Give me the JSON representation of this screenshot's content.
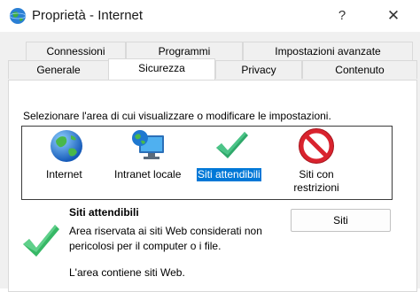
{
  "window": {
    "title": "Proprietà - Internet",
    "help_label": "?",
    "close_label": "✕"
  },
  "tabs": {
    "row1": [
      "Connessioni",
      "Programmi",
      "Impostazioni avanzate"
    ],
    "row2": [
      "Generale",
      "Sicurezza",
      "Privacy",
      "Contenuto"
    ],
    "active": "Sicurezza"
  },
  "security": {
    "instruction": "Selezionare l'area di cui visualizzare o modificare le impostazioni.",
    "zones": [
      {
        "label": "Internet",
        "icon": "globe-icon"
      },
      {
        "label": "Intranet locale",
        "icon": "intranet-icon"
      },
      {
        "label": "Siti attendibili",
        "icon": "checkmark-icon",
        "selected": true
      },
      {
        "label": "Siti con restrizioni",
        "icon": "prohibited-icon"
      }
    ],
    "selected_zone": {
      "title": "Siti attendibili",
      "description": "Area riservata ai siti Web considerati non pericolosi per il computer o i file.",
      "note": "L'area contiene siti Web."
    },
    "sites_button": "Siti"
  },
  "colors": {
    "selection": "#0078d7",
    "check_green": "#2fa86a",
    "prohibited_red": "#d9232e"
  }
}
